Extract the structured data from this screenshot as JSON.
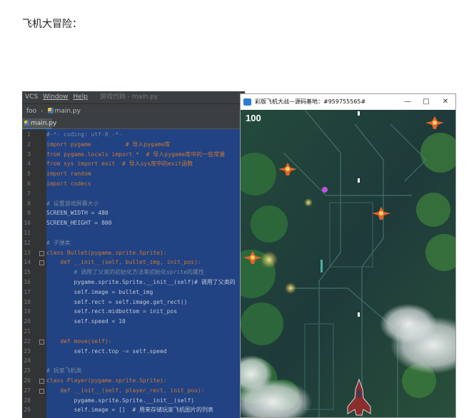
{
  "heading": "飞机大冒险：",
  "ide": {
    "menu": [
      "VCS",
      "Window",
      "Help"
    ],
    "title": "游戏代码 - main.py",
    "breadcrumb": {
      "project": "foo",
      "file": "main.py"
    },
    "tab": "main.py",
    "lines": [
      "#-*- coding: utf-8 -*-",
      "import pygame          # 导入pygame库",
      "from pygame.locals import *  # 导入pygame库中的一些常量",
      "from sys import exit  # 导入sys库中的exit函数",
      "import random",
      "import codecs",
      "",
      "# 设置游戏屏幕大小",
      "SCREEN_WIDTH = 480",
      "SCREEN_HEIGHT = 800",
      "",
      "# 子弹类",
      "class Bullet(pygame.sprite.Sprite):",
      "    def __init__(self, bullet_img, init_pos):",
      "        # 调用了父类的初始化方法来初始化sprite的属性",
      "        pygame.sprite.Sprite.__init__(self)# 调用了父类的",
      "        self.image = bullet_img",
      "        self.rect = self.image.get_rect()",
      "        self.rect.midbottom = init_pos",
      "        self.speed = 10",
      "",
      "    def move(self):",
      "        self.rect.top -= self.speed",
      "",
      "# 玩家飞机类",
      "class Player(pygame.sprite.Sprite):",
      "    def __init__(self, player_rect, init_pos):",
      "        pygame.sprite.Sprite.__init__(self)",
      "        self.image = []  # 用来存储玩家飞机图片的列表"
    ]
  },
  "game": {
    "window_title": "彩版飞机大战—源码基地：#959755565#",
    "controls": {
      "minimize": "—",
      "maximize": "□",
      "close": "✕"
    },
    "score": "100"
  },
  "colors": {
    "selection": "#214283",
    "keyword": "#cc7832",
    "comment": "#7a8a9a",
    "enemy": "#e0642a"
  }
}
